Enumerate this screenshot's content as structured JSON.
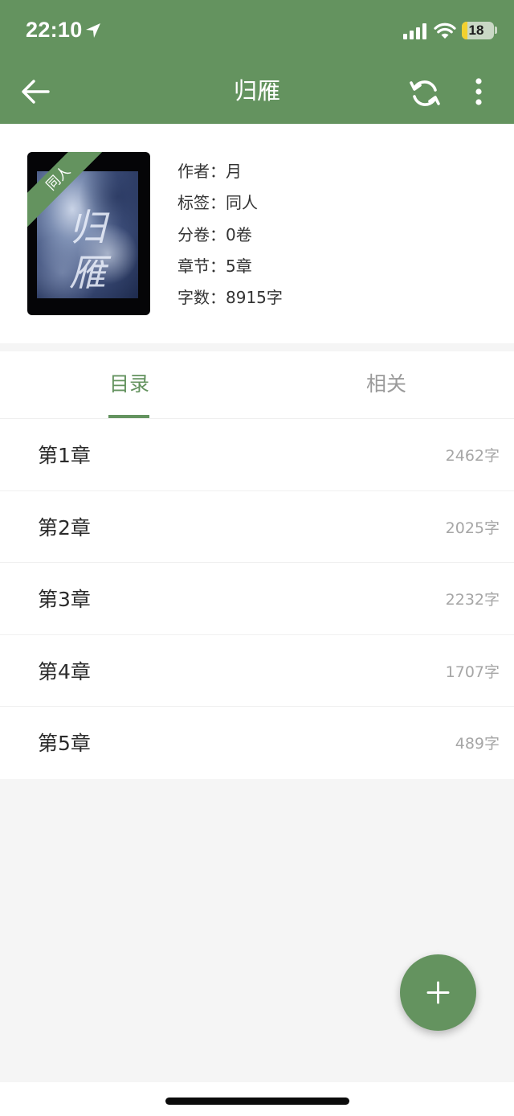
{
  "status_bar": {
    "time": "22:10",
    "battery": "18",
    "battery_level": 0.18,
    "icons": [
      "location-arrow-icon",
      "cellular-signal-icon",
      "wifi-icon",
      "battery-icon"
    ]
  },
  "toolbar": {
    "title": "归雁",
    "back_icon": "arrow-left-icon",
    "refresh_icon": "refresh-icon",
    "more_icon": "more-vertical-icon"
  },
  "book": {
    "cover_badge": "同人",
    "cover_glyphs": "归雁",
    "meta": [
      {
        "label": "作者：",
        "value": "月"
      },
      {
        "label": "标签：",
        "value": "同人"
      },
      {
        "label": "分卷：",
        "value": "0卷"
      },
      {
        "label": "章节：",
        "value": "5章"
      },
      {
        "label": "字数：",
        "value": "8915字"
      }
    ]
  },
  "tabs": [
    {
      "label": "目录",
      "active": true
    },
    {
      "label": "相关",
      "active": false
    }
  ],
  "chapters": [
    {
      "title": "第1章",
      "count": "2462字"
    },
    {
      "title": "第2章",
      "count": "2025字"
    },
    {
      "title": "第3章",
      "count": "2232字"
    },
    {
      "title": "第4章",
      "count": "1707字"
    },
    {
      "title": "第5章",
      "count": "489字"
    }
  ],
  "fab": {
    "icon": "plus-icon"
  },
  "colors": {
    "accent": "#64935f",
    "background": "#f5f5f5"
  }
}
